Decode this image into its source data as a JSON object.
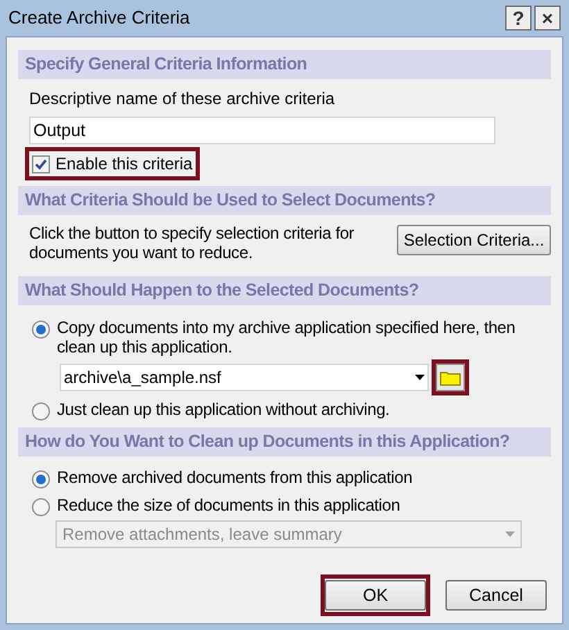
{
  "window": {
    "title": "Create Archive Criteria",
    "title_buttons": [
      "?",
      "×"
    ]
  },
  "general": {
    "heading": "Specify General Criteria Information",
    "name_label": "Descriptive name of these archive criteria",
    "name_value": "Output",
    "enable": {
      "label": "Enable this criteria",
      "checked": true,
      "highlighted": true
    }
  },
  "selection": {
    "heading": "What Criteria Should be Used to Select Documents?",
    "text": "Click the button to specify selection criteria for documents you want to reduce.",
    "button": "Selection Criteria..."
  },
  "action": {
    "heading": "What Should Happen to the Selected Documents?",
    "options": [
      {
        "label": "Copy documents into my archive application specified here, then clean up this application.",
        "selected": true
      },
      {
        "label": "Just clean up this application without archiving.",
        "selected": false
      }
    ],
    "archive_path": "archive\\a_sample.nsf",
    "folder_button_highlighted": true
  },
  "cleanup": {
    "heading": "How do You Want to Clean up Documents in this Application?",
    "options": [
      {
        "label": "Remove archived documents from this application",
        "selected": true
      },
      {
        "label": "Reduce the size of documents in this application",
        "selected": false
      }
    ],
    "reduce_mode": {
      "value": "Remove attachments, leave summary",
      "disabled": true
    }
  },
  "buttons": [
    {
      "label": "OK",
      "highlighted": true
    },
    {
      "label": "Cancel",
      "highlighted": false
    }
  ]
}
